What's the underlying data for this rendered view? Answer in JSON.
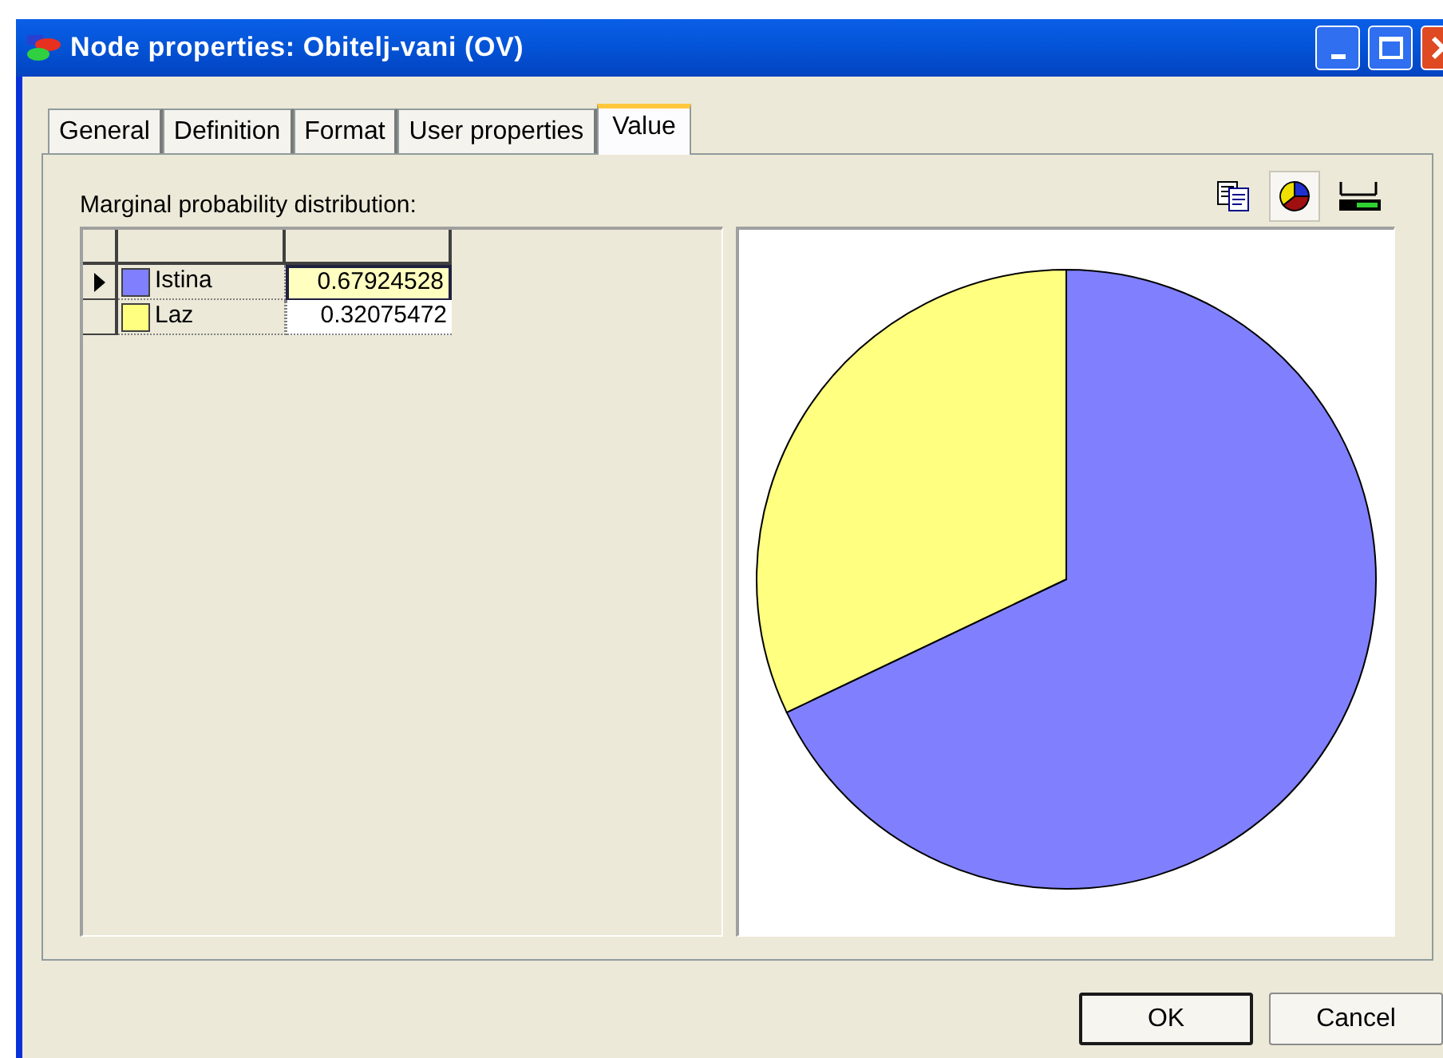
{
  "window": {
    "title": "Node properties: Obitelj-vani (OV)"
  },
  "tabs": [
    {
      "label": "General",
      "selected": false
    },
    {
      "label": "Definition",
      "selected": false
    },
    {
      "label": "Format",
      "selected": false
    },
    {
      "label": "User properties",
      "selected": false
    },
    {
      "label": "Value",
      "selected": true
    }
  ],
  "panel": {
    "label": "Marginal probability distribution:"
  },
  "toolbar": [
    {
      "kind": "copy",
      "selected": false
    },
    {
      "kind": "pie",
      "selected": true
    },
    {
      "kind": "bar",
      "selected": false
    }
  ],
  "table": {
    "rows": [
      {
        "name": "Istina",
        "color": "#8080ff",
        "value": "0.67924528",
        "selected": true
      },
      {
        "name": "Laz",
        "color": "#ffff80",
        "value": "0.32075472",
        "selected": false
      }
    ]
  },
  "chart_data": {
    "type": "pie",
    "values": [
      0.67924528,
      0.32075472
    ]
  },
  "buttons": [
    {
      "label": "OK",
      "default": true
    },
    {
      "label": "Cancel",
      "default": false
    }
  ]
}
